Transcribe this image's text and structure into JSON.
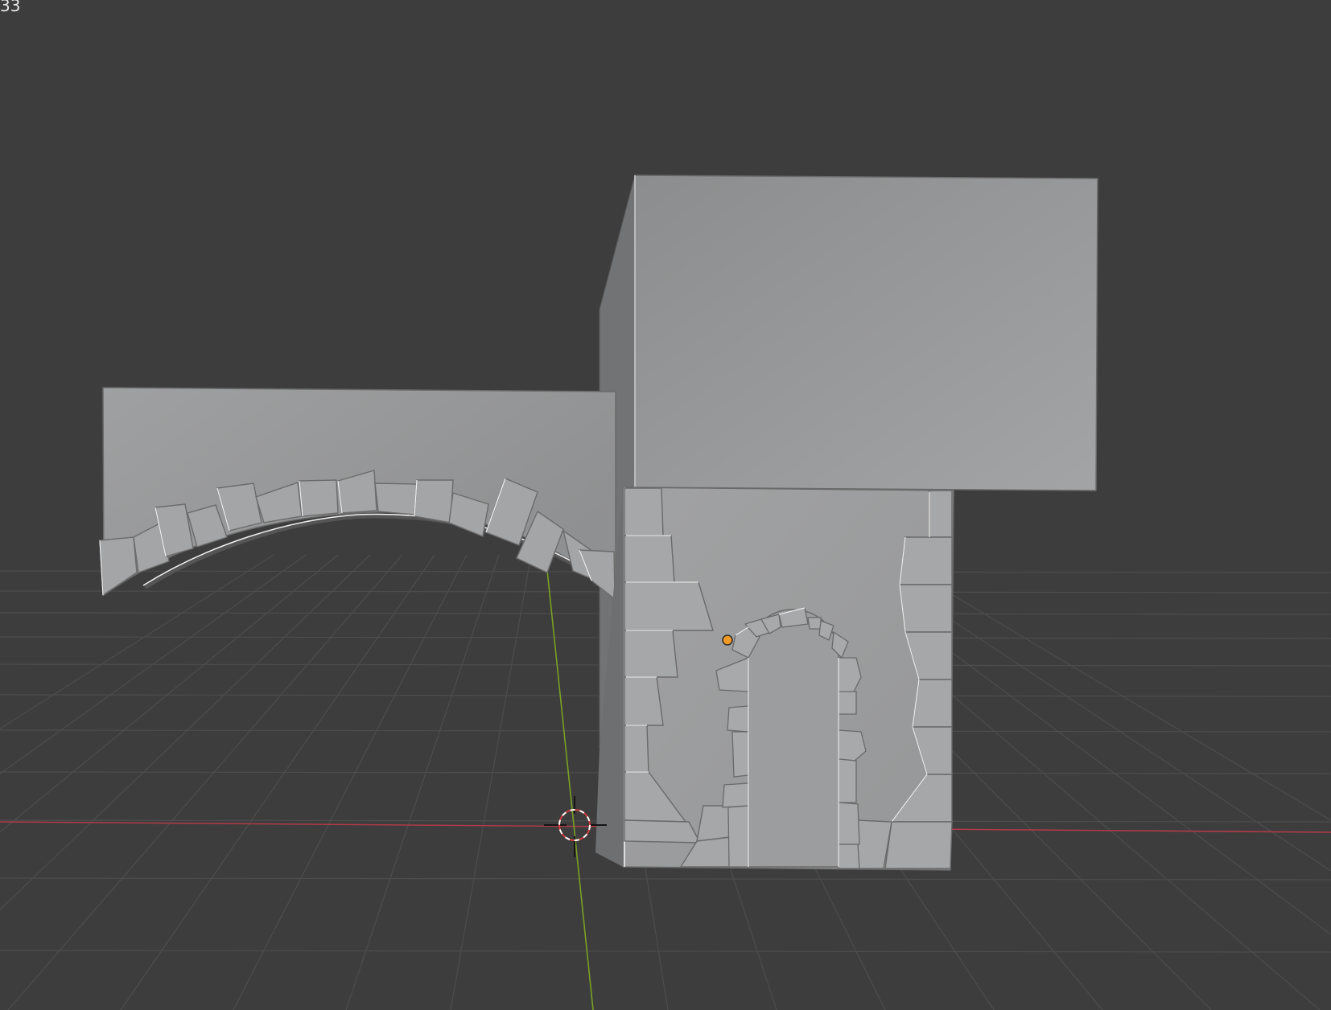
{
  "viewport": {
    "corner_text": "33",
    "background_color": "#3d3d3d",
    "grid_color": "#4d4d4d",
    "x_axis_color": "#b03a48",
    "y_axis_color": "#7aa024",
    "model_color": "#9c9d9e",
    "origin_color": "#f09a26",
    "cursor_icon": "3d-cursor-icon",
    "origin_icon": "object-origin-icon"
  }
}
